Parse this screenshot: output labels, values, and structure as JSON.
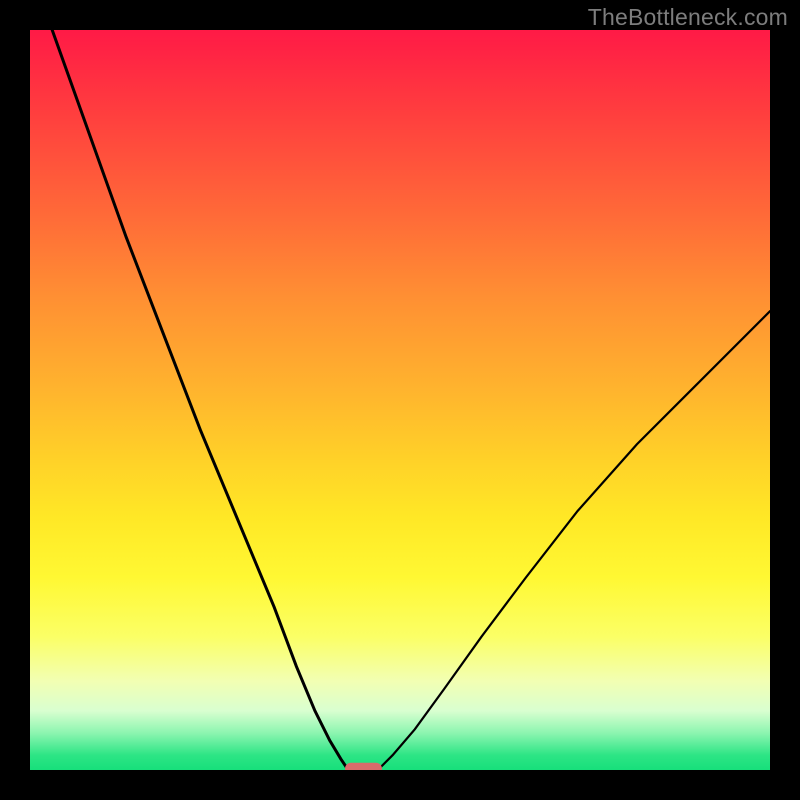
{
  "watermark": "TheBottleneck.com",
  "chart_data": {
    "type": "line",
    "title": "",
    "xlabel": "",
    "ylabel": "",
    "xlim": [
      0,
      100
    ],
    "ylim": [
      0,
      100
    ],
    "grid": false,
    "legend": false,
    "series": [
      {
        "name": "left-branch",
        "x": [
          3,
          8,
          13,
          18,
          23,
          28,
          33,
          36,
          38.5,
          40.5,
          42,
          43
        ],
        "y": [
          100,
          86,
          72,
          59,
          46,
          34,
          22,
          14,
          8,
          4,
          1.5,
          0
        ]
      },
      {
        "name": "right-branch",
        "x": [
          47,
          49,
          52,
          56,
          61,
          67,
          74,
          82,
          90,
          100
        ],
        "y": [
          0,
          2,
          5.5,
          11,
          18,
          26,
          35,
          44,
          52,
          62
        ]
      }
    ],
    "marker": {
      "x_center": 45,
      "width_pct": 5,
      "color": "#d96b6b"
    }
  },
  "colors": {
    "curve": "#000000",
    "background_frame": "#000000",
    "watermark": "#7d7d7d"
  }
}
